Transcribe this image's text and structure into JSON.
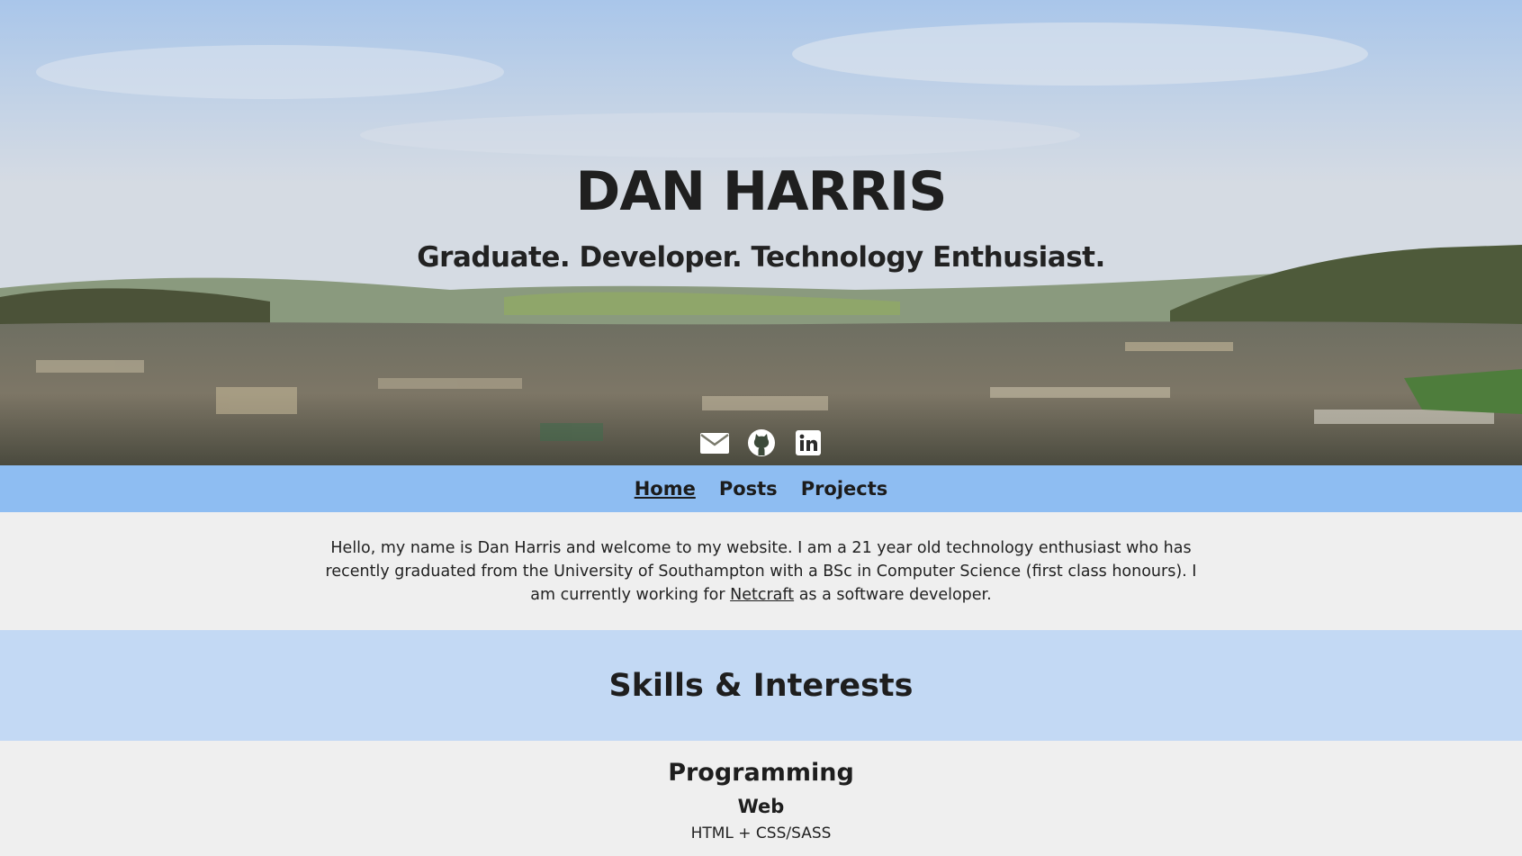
{
  "hero": {
    "title": "DAN HARRIS",
    "subtitle": "Graduate. Developer. Technology Enthusiast.",
    "social_links": [
      {
        "icon": "envelope-icon"
      },
      {
        "icon": "github-icon"
      },
      {
        "icon": "linkedin-icon"
      }
    ]
  },
  "nav": {
    "items": [
      {
        "label": "Home",
        "active": true
      },
      {
        "label": "Posts",
        "active": false
      },
      {
        "label": "Projects",
        "active": false
      }
    ]
  },
  "intro": {
    "text_before": "Hello, my name is Dan Harris and welcome to my website. I am a 21 year old technology enthusiast who has recently graduated from the University of Southampton with a BSc in Computer Science (first class honours). I am currently working for ",
    "link_text": "Netcraft",
    "text_after": " as a software developer."
  },
  "skills": {
    "heading": "Skills & Interests",
    "category": "Programming",
    "subcategory": "Web",
    "items": [
      "HTML + CSS/SASS"
    ]
  },
  "colors": {
    "nav_bg": "#8ebdf2",
    "skills_header_bg": "#c3d9f4",
    "page_bg": "#efefef",
    "text": "#1e1e1e"
  }
}
